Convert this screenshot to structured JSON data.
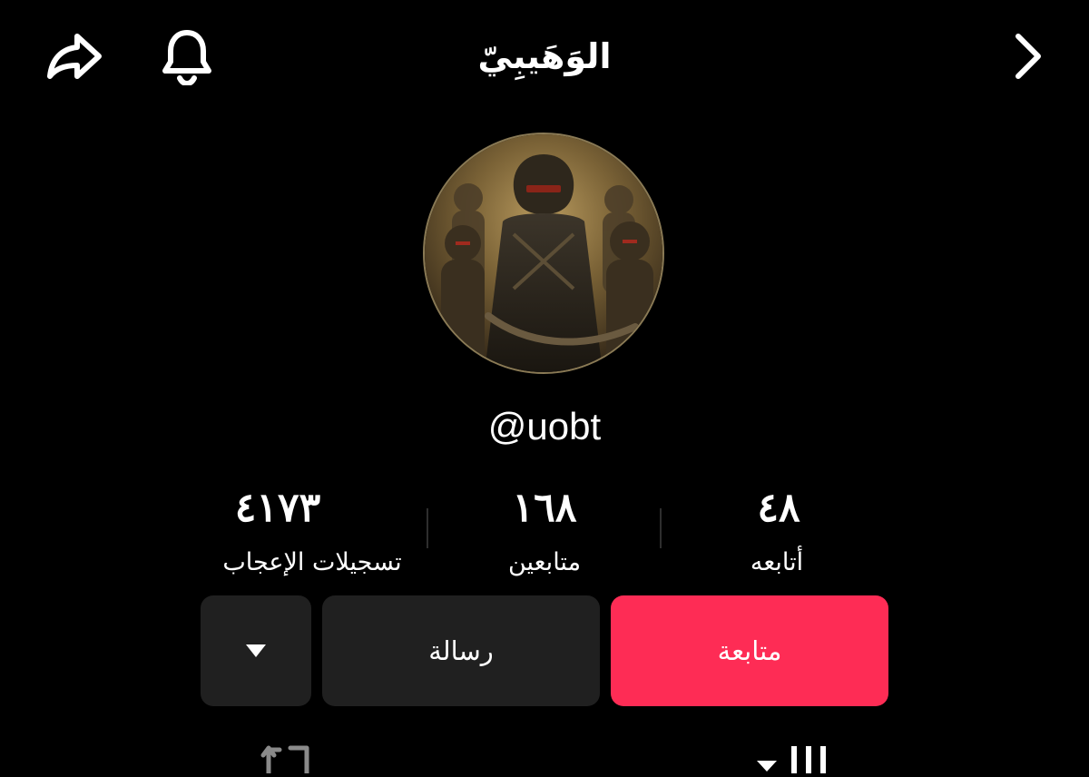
{
  "header": {
    "title": "الوَهَيبِيّ",
    "share_icon": "share-arrow-icon",
    "bell_icon": "bell-icon",
    "back_icon": "chevron-right-icon"
  },
  "profile": {
    "handle": "@uobt",
    "avatar": "avatar-image"
  },
  "stats": [
    {
      "value": "٤١٧٣",
      "label": "تسجيلات الإعجاب"
    },
    {
      "value": "١٦٨",
      "label": "متابعين"
    },
    {
      "value": "٤٨",
      "label": "أتابعه"
    }
  ],
  "actions": {
    "follow_label": "متابعة",
    "message_label": "رسالة",
    "more_icon": "caret-down-icon"
  },
  "tabs": {
    "repost_icon": "repost-icon",
    "videos_icon": "video-grid-icon"
  },
  "colors": {
    "background": "#000000",
    "accent": "#fe2c55",
    "secondary_button": "#202020"
  }
}
